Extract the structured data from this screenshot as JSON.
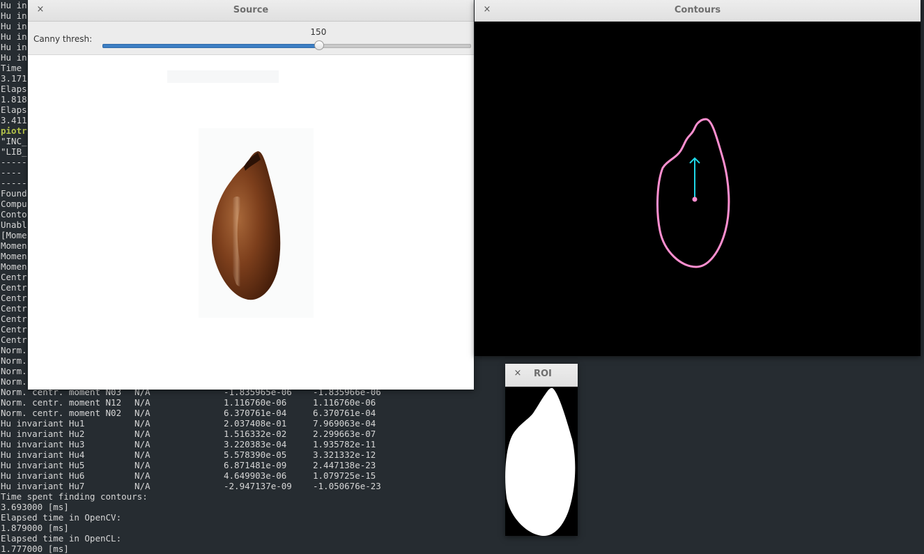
{
  "terminal": {
    "partial_lines": [
      "Hu in",
      "Hu in",
      "Hu in",
      "Hu in",
      "Hu in",
      "Hu in",
      "Time ",
      "3.171",
      "Elaps",
      "1.818",
      "Elaps",
      "3.411",
      "piotr",
      "\"INC_",
      "\"LIB_",
      "-----",
      "---- ",
      "-----",
      "Found",
      "Compu",
      "Conto",
      "Unabl",
      "[Mome",
      "Momen",
      "Momen",
      "Momen",
      "Centr",
      "Centr",
      "Centr",
      "Centr",
      "Centr",
      "Centr",
      "Centr",
      "Norm.",
      "Norm.",
      "Norm.",
      "Norm."
    ],
    "highlight_index": 12,
    "table_rows": [
      {
        "name": "Norm. centr. moment N03",
        "a": "N/A",
        "b": "-1.835965e-06",
        "c": "-1.835966e-06"
      },
      {
        "name": "Norm. centr. moment N12",
        "a": "N/A",
        "b": "1.116760e-06",
        "c": "1.116760e-06"
      },
      {
        "name": "Norm. centr. moment N02",
        "a": "N/A",
        "b": "6.370761e-04",
        "c": "6.370761e-04"
      },
      {
        "name": "Hu invariant Hu1",
        "a": "N/A",
        "b": "2.037408e-01",
        "c": "7.969063e-04"
      },
      {
        "name": "Hu invariant Hu2",
        "a": "N/A",
        "b": "1.516332e-02",
        "c": "2.299663e-07"
      },
      {
        "name": "Hu invariant Hu3",
        "a": "N/A",
        "b": "3.220383e-04",
        "c": "1.935782e-11"
      },
      {
        "name": "Hu invariant Hu4",
        "a": "N/A",
        "b": "5.578390e-05",
        "c": "3.321332e-12"
      },
      {
        "name": "Hu invariant Hu5",
        "a": "N/A",
        "b": "6.871481e-09",
        "c": "2.447138e-23"
      },
      {
        "name": "Hu invariant Hu6",
        "a": "N/A",
        "b": "4.649903e-06",
        "c": "1.079725e-15"
      },
      {
        "name": "Hu invariant Hu7",
        "a": "N/A",
        "b": "-2.947137e-09",
        "c": "-1.050676e-23"
      }
    ],
    "trailing_lines": [
      "Time spent finding contours:",
      "3.693000 [ms]",
      "Elapsed time in OpenCV:",
      "1.879000 [ms]",
      "Elapsed time in OpenCL:",
      "1.777000 [ms]"
    ]
  },
  "source_window": {
    "title": "Source",
    "close_icon": "×",
    "trackbar_label": "Canny thresh:",
    "trackbar_value": "150",
    "trackbar_fraction": 0.588
  },
  "contours_window": {
    "title": "Contours",
    "close_icon": "×",
    "contour_color": "#ff8fd0",
    "arrow_color": "#1ed6e6"
  },
  "roi_window": {
    "title": "ROI",
    "close_icon": "×"
  }
}
